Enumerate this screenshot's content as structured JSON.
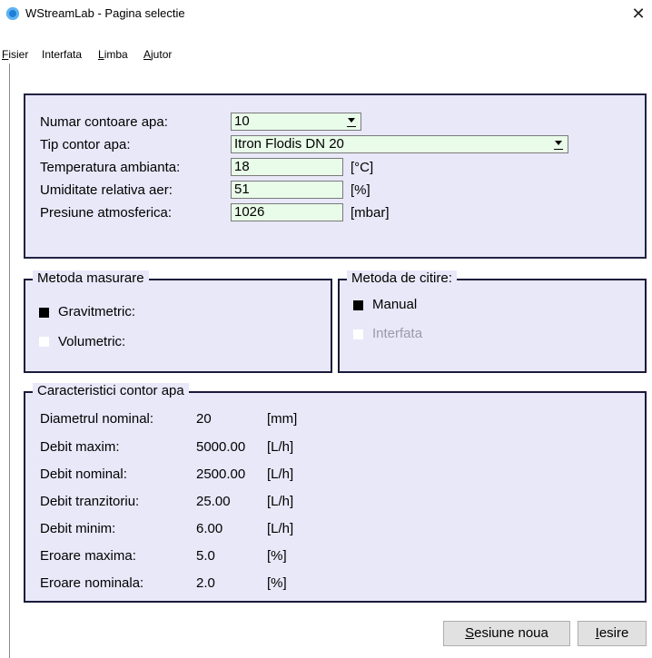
{
  "window": {
    "title": "WStreamLab - Pagina selectie",
    "close_glyph": "✕"
  },
  "menu": [
    {
      "accel": "F",
      "rest": "isier"
    },
    {
      "accel": "",
      "rest": "Interfata"
    },
    {
      "accel": "L",
      "rest": "imba"
    },
    {
      "accel": "A",
      "rest": "jutor"
    }
  ],
  "config": {
    "meter_count_label": "Numar contoare apa:",
    "meter_count_value": "10",
    "meter_type_label": "Tip contor apa:",
    "meter_type_value": "Itron Flodis DN 20",
    "temp_label": "Temperatura ambianta:",
    "temp_value": "18",
    "temp_unit": "[°C]",
    "humidity_label": "Umiditate relativa aer:",
    "humidity_value": "51",
    "humidity_unit": "[%]",
    "pressure_label": "Presiune atmosferica:",
    "pressure_value": "1026",
    "pressure_unit": "[mbar]"
  },
  "measure_method": {
    "title": "Metoda masurare",
    "options": [
      {
        "label": "Gravitmetric:",
        "selected": true
      },
      {
        "label": "Volumetric:",
        "selected": false
      }
    ]
  },
  "read_method": {
    "title": "Metoda de citire:",
    "options": [
      {
        "label": "Manual",
        "selected": true,
        "enabled": true
      },
      {
        "label": "Interfata",
        "selected": false,
        "enabled": false
      }
    ]
  },
  "characteristics": {
    "title": "Caracteristici contor apa",
    "rows": [
      {
        "label": "Diametrul nominal:",
        "value": "20",
        "unit": "[mm]"
      },
      {
        "label": "Debit maxim:",
        "value": "5000.00",
        "unit": "[L/h]"
      },
      {
        "label": "Debit nominal:",
        "value": "2500.00",
        "unit": "[L/h]"
      },
      {
        "label": "Debit tranzitoriu:",
        "value": "25.00",
        "unit": "[L/h]"
      },
      {
        "label": "Debit minim:",
        "value": "6.00",
        "unit": "[L/h]"
      },
      {
        "label": "Eroare maxima:",
        "value": "5.0",
        "unit": "[%]"
      },
      {
        "label": "Eroare nominala:",
        "value": "2.0",
        "unit": "[%]"
      }
    ]
  },
  "buttons": {
    "new_session": {
      "accel": "S",
      "rest": "esiune noua"
    },
    "exit": {
      "accel": "I",
      "rest": "esire"
    }
  },
  "colors": {
    "panel_bg": "#e8e8f9",
    "field_bg": "#e9fbe9",
    "border": "#1a1a3a"
  }
}
